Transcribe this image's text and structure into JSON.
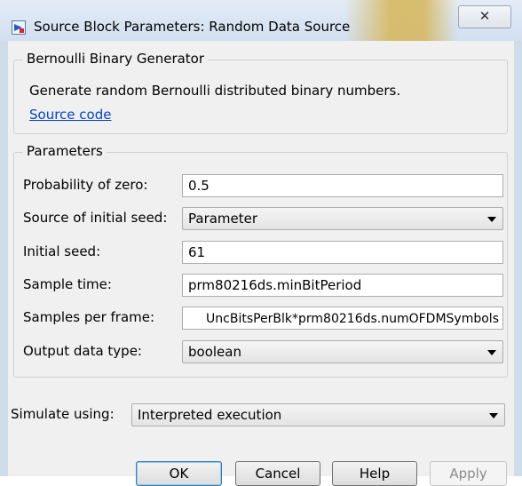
{
  "window": {
    "title": "Source Block Parameters: Random Data Source",
    "close_glyph": "✕"
  },
  "block": {
    "name": "Bernoulli Binary Generator",
    "description": "Generate random Bernoulli distributed binary numbers.",
    "source_link": "Source code"
  },
  "parameters": {
    "legend": "Parameters",
    "probability_zero": {
      "label": "Probability of zero:",
      "value": "0.5"
    },
    "seed_source": {
      "label": "Source of initial seed:",
      "value": "Parameter"
    },
    "initial_seed": {
      "label": "Initial seed:",
      "value": "61"
    },
    "sample_time": {
      "label": "Sample time:",
      "value": "prm80216ds.minBitPeriod"
    },
    "samples_per_frame": {
      "label": "Samples per frame:",
      "value": "UncBitsPerBlk*prm80216ds.numOFDMSymbols"
    },
    "output_type": {
      "label": "Output data type:",
      "value": "boolean"
    }
  },
  "simulate": {
    "label": "Simulate using:",
    "value": "Interpreted execution"
  },
  "buttons": {
    "ok": "OK",
    "cancel": "Cancel",
    "help": "Help",
    "apply": "Apply"
  },
  "colors": {
    "link": "#0044cc",
    "accent": "#3c7fb1"
  },
  "icons": {
    "app": "simulink-block-icon",
    "dropdown": "chevron-down-icon"
  }
}
